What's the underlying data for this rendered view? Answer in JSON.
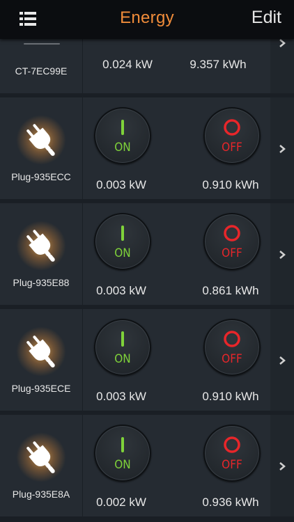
{
  "header": {
    "title": "Energy",
    "edit_label": "Edit"
  },
  "colors": {
    "accent": "#f08c3a",
    "on": "#7fd23a",
    "off": "#e8262a"
  },
  "ct_row": {
    "name": "CT-7EC99E",
    "power": "0.024 kW",
    "energy": "9.357 kWh"
  },
  "plugs": [
    {
      "name": "Plug-935ECC",
      "power": "0.003 kW",
      "energy": "0.910 kWh",
      "on_label": "ON",
      "off_label": "OFF"
    },
    {
      "name": "Plug-935E88",
      "power": "0.003 kW",
      "energy": "0.861 kWh",
      "on_label": "ON",
      "off_label": "OFF"
    },
    {
      "name": "Plug-935ECE",
      "power": "0.003 kW",
      "energy": "0.910 kWh",
      "on_label": "ON",
      "off_label": "OFF"
    },
    {
      "name": "Plug-935E8A",
      "power": "0.002 kW",
      "energy": "0.936 kWh",
      "on_label": "ON",
      "off_label": "OFF"
    }
  ],
  "icons": {
    "menu": "list-menu-icon",
    "plug": "plug-icon",
    "chevron": "chevron-right-icon",
    "power_on": "power-on-icon",
    "power_off": "power-off-icon"
  }
}
